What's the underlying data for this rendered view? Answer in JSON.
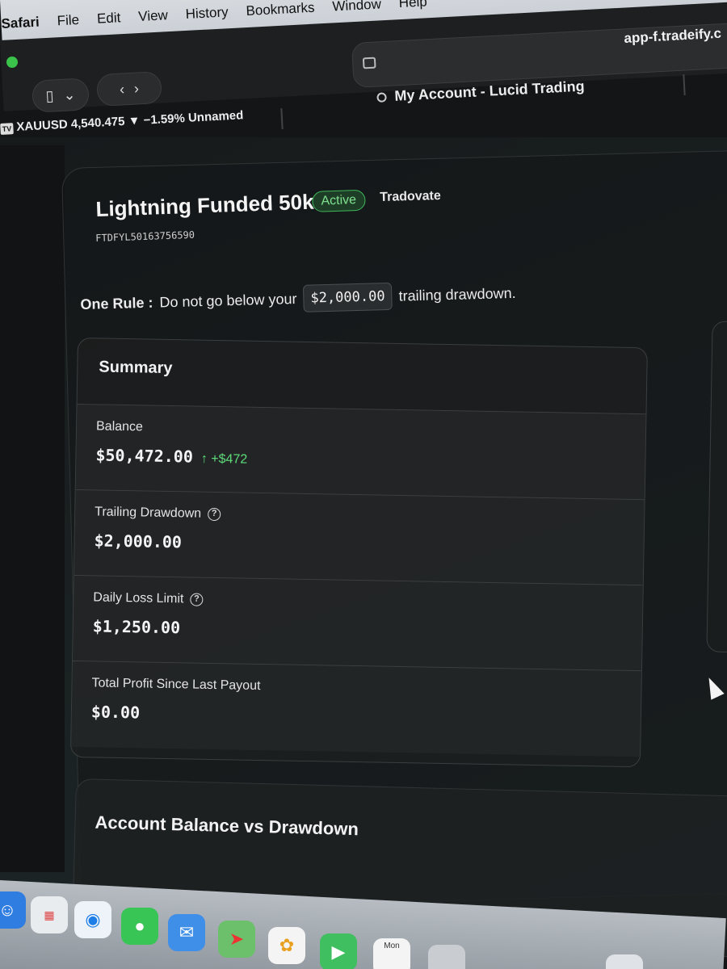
{
  "menubar": {
    "items": [
      "Safari",
      "File",
      "Edit",
      "View",
      "History",
      "Bookmarks",
      "Window",
      "Help"
    ]
  },
  "browser": {
    "address": "app-f.tradeify.c",
    "tab_title": "My Account - Lucid Trading",
    "ticker": "XAUUSD 4,540.475 ▼ −1.59% Unnamed"
  },
  "account": {
    "name": "Lightning Funded 50k",
    "status": "Active",
    "platform": "Tradovate",
    "id": "FTDFYL50163756590",
    "rule_label": "One Rule :",
    "rule_prefix": "Do not go below your",
    "rule_amount": "$2,000.00",
    "rule_suffix": "trailing drawdown."
  },
  "summary": {
    "title": "Summary",
    "balance_label": "Balance",
    "balance_value": "$50,472.00",
    "balance_delta": "↑ +$472",
    "trailing_label": "Trailing Drawdown",
    "trailing_value": "$2,000.00",
    "daily_label": "Daily Loss Limit",
    "daily_value": "$1,250.00",
    "profit_label": "Total Profit Since Last Payout",
    "profit_value": "$0.00"
  },
  "chart_section": {
    "title": "Account Balance vs Drawdown"
  },
  "dock": {
    "calendar_label": "Mon"
  },
  "colors": {
    "active_green": "#3fb85a",
    "delta_green": "#5fdc7a",
    "background": "#131516"
  }
}
